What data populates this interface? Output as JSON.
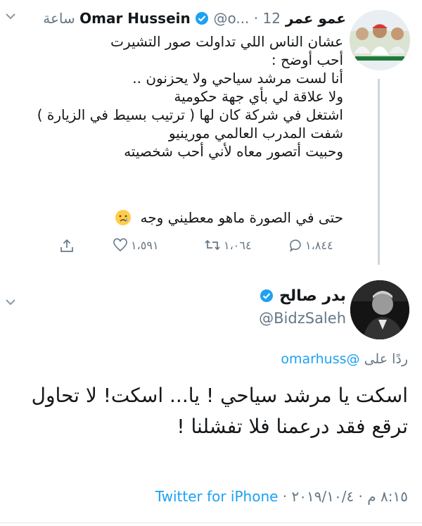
{
  "tweet1": {
    "display_name": "عمو عمر Omar Hussein",
    "handle": "@o...",
    "time": "12 ساعة",
    "lines": [
      "عشان الناس اللي تداولت صور التشيرت",
      "أحب أوضح :",
      "أنا لست مرشد سياحي  ولا يحزنون ..",
      "ولا علاقة لي بأي جهة حكومية",
      "اشتغل في شركة كان لها ( ترتيب بسيط في الزيارة )",
      "شفت المدرب العالمي مورينيو",
      "وحبيت أتصور معاه لأني أحب شخصيته"
    ],
    "last_line": "حتى في الصورة ماهو معطيني وجه",
    "emoji_icon": "crying-face-emoji",
    "actions": {
      "replies": "١،٨٤٤",
      "retweets": "١،٠٦٤",
      "likes": "١،٥٩١"
    }
  },
  "tweet2": {
    "display_name": "بدر صالح",
    "handle": "@BidzSaleh",
    "reply_prefix": "ردًا على",
    "reply_to": "@omarhuss",
    "lines": [
      "اسكت يا مرشد سياحي ! يا... اسكت! لا تحاول",
      "ترقع فقد درعمنا فلا تفشلنا !"
    ],
    "time": "٨:١٥ م",
    "date": "٢٠١٩/١٠/٤",
    "client": "Twitter for iPhone"
  },
  "colors": {
    "accent": "#1da1f2",
    "muted": "#657786",
    "thread_line": "#ccd6dd"
  }
}
